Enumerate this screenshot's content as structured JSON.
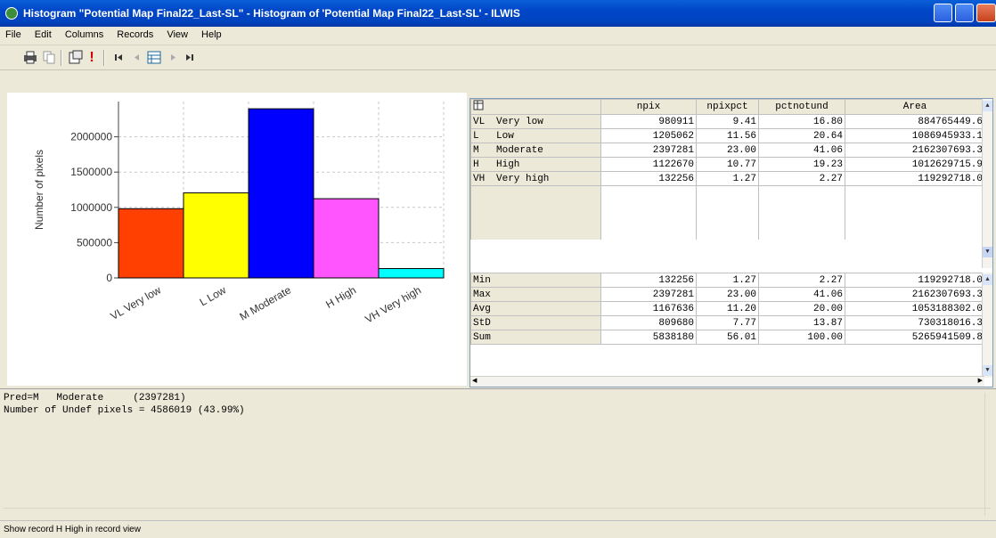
{
  "window": {
    "title": "Histogram \"Potential Map Final22_Last-SL\" - Histogram of 'Potential Map Final22_Last-SL' - ILWIS"
  },
  "menu": [
    "File",
    "Edit",
    "Columns",
    "Records",
    "View",
    "Help"
  ],
  "toolbar": {
    "icons": [
      "print-icon",
      "copy-icon",
      "properties-icon",
      "exclamation-icon",
      "first-record-icon",
      "prev-record-icon",
      "record-view-icon",
      "next-record-icon",
      "last-record-icon"
    ],
    "exclamation_glyph": "!"
  },
  "chart_data": {
    "type": "bar",
    "ylabel": "Number of pixels",
    "categories": [
      "VL  Very low",
      "L  Low",
      "M  Moderate",
      "H  High",
      "VH  Very high"
    ],
    "values": [
      980911,
      1205062,
      2397281,
      1122670,
      132256
    ],
    "colors": [
      "#ff4000",
      "#ffff00",
      "#0000ff",
      "#ff55ff",
      "#00ffff"
    ],
    "ylim": [
      0,
      2500000
    ],
    "yticks": [
      "0",
      "500000",
      "1000000",
      "1500000",
      "2000000"
    ],
    "grid": true
  },
  "table": {
    "columns": [
      "npix",
      "npixpct",
      "pctnotund",
      "Area"
    ],
    "rows": [
      {
        "code": "VL",
        "name": "Very low",
        "npix": "980911",
        "npixpct": "9.41",
        "pctnotund": "16.80",
        "area": "884765449.6"
      },
      {
        "code": "L",
        "name": "Low",
        "npix": "1205062",
        "npixpct": "11.56",
        "pctnotund": "20.64",
        "area": "1086945933.1"
      },
      {
        "code": "M",
        "name": "Moderate",
        "npix": "2397281",
        "npixpct": "23.00",
        "pctnotund": "41.06",
        "area": "2162307693.3"
      },
      {
        "code": "H",
        "name": "High",
        "npix": "1122670",
        "npixpct": "10.77",
        "pctnotund": "19.23",
        "area": "1012629715.9"
      },
      {
        "code": "VH",
        "name": "Very high",
        "npix": "132256",
        "npixpct": "1.27",
        "pctnotund": "2.27",
        "area": "119292718.0"
      }
    ],
    "stats": [
      {
        "label": "Min",
        "npix": "132256",
        "npixpct": "1.27",
        "pctnotund": "2.27",
        "area": "119292718.0"
      },
      {
        "label": "Max",
        "npix": "2397281",
        "npixpct": "23.00",
        "pctnotund": "41.06",
        "area": "2162307693.3"
      },
      {
        "label": "Avg",
        "npix": "1167636",
        "npixpct": "11.20",
        "pctnotund": "20.00",
        "area": "1053188302.0"
      },
      {
        "label": "StD",
        "npix": "809680",
        "npixpct": "7.77",
        "pctnotund": "13.87",
        "area": "730318016.3"
      },
      {
        "label": "Sum",
        "npix": "5838180",
        "npixpct": "56.01",
        "pctnotund": "100.00",
        "area": "5265941509.8"
      }
    ]
  },
  "output": {
    "line1": "Pred=M   Moderate     (2397281)",
    "line2": "Number of Undef pixels = 4586019 (43.99%)"
  },
  "status": "Show record H  High in record view"
}
